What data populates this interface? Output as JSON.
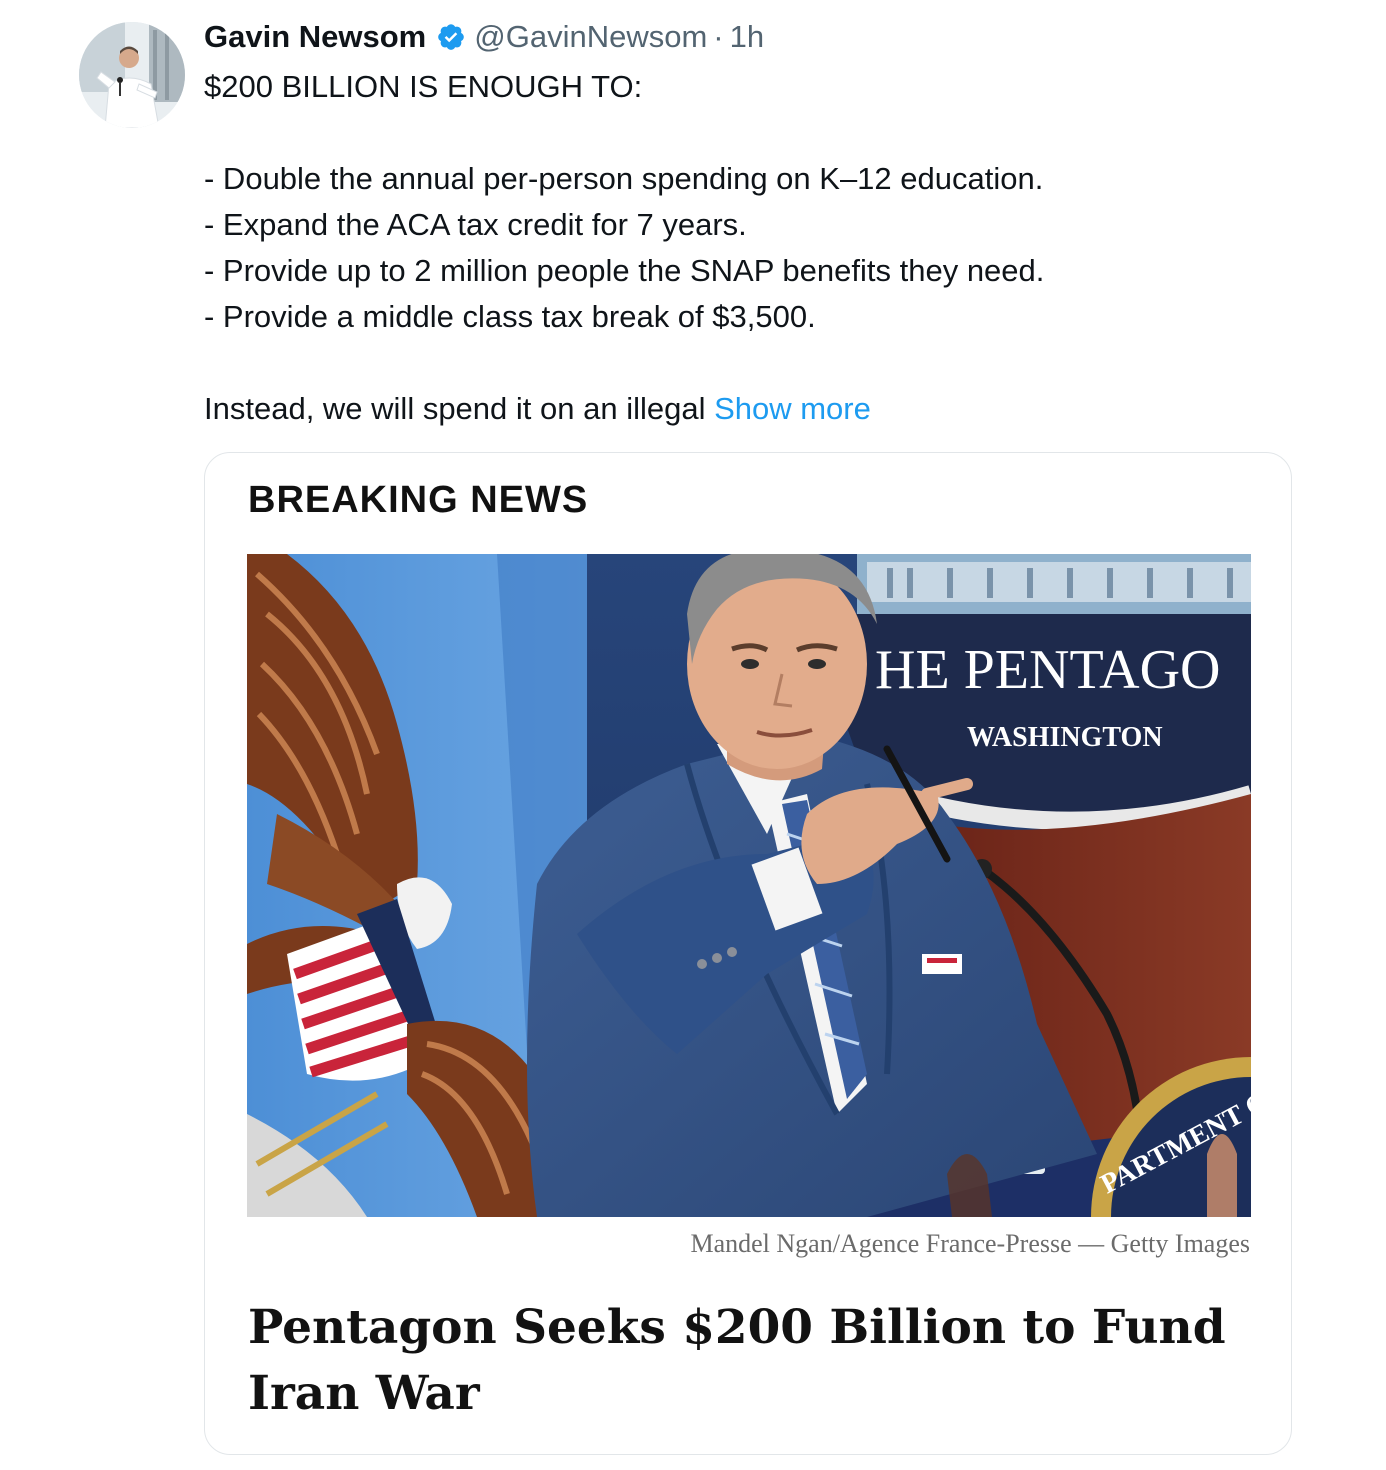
{
  "tweet": {
    "display_name": "Gavin Newsom",
    "handle": "@GavinNewsom",
    "separator": "·",
    "time": "1h",
    "verified_icon": "verified-badge-icon",
    "avatar_icon": "avatar-photo",
    "lines": [
      "$200 BILLION IS ENOUGH TO:",
      "",
      "- Double the annual per-person spending on K–12 education.",
      "- Expand the ACA tax credit for 7 years.",
      "- Provide up to 2 million people the SNAP benefits they need.",
      "- Provide a middle class tax break of $3,500.",
      ""
    ],
    "last_line": "Instead, we will spend it on an illegal ",
    "show_more": "Show more"
  },
  "card": {
    "kicker": "BREAKING NEWS",
    "photo": {
      "sign_line1": "HE PENTAGO",
      "sign_line2": "WASHINGTON",
      "seal_text": "PARTMENT O"
    },
    "credit": "Mandel Ngan/Agence France-Presse — Getty Images",
    "headline": "Pentagon Seeks $200 Billion to Fund Iran War"
  },
  "colors": {
    "link": "#1d9bf0",
    "verified": "#1d9bf0",
    "secondary_text": "#536471",
    "card_border": "#e2e6e9"
  }
}
